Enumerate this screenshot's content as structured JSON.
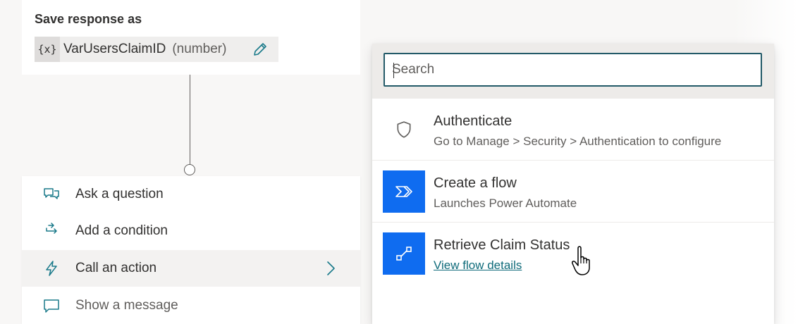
{
  "save_response": {
    "title": "Save response as",
    "var_icon": "{x}",
    "var_name": "VarUsersClaimID",
    "var_type": "(number)",
    "edit_icon": "pencil-icon"
  },
  "action_menu": {
    "items": [
      {
        "label": "Ask a question",
        "icon": "chat-question-icon"
      },
      {
        "label": "Add a condition",
        "icon": "branch-icon"
      },
      {
        "label": "Call an action",
        "icon": "lightning-icon"
      },
      {
        "label": "Show a message",
        "icon": "message-icon"
      }
    ]
  },
  "flyout": {
    "search": {
      "placeholder": "Search",
      "value": ""
    },
    "items": [
      {
        "title": "Authenticate",
        "subtitle": "Go to Manage > Security > Authentication to configure",
        "icon": "shield-icon"
      },
      {
        "title": "Create a flow",
        "subtitle": "Launches Power Automate",
        "icon": "power-automate-icon"
      },
      {
        "title": "Retrieve Claim Status",
        "link": "View flow details",
        "icon": "flow-icon"
      }
    ]
  },
  "colors": {
    "accent_blue": "#0f6cf0",
    "search_border": "#235a68",
    "link": "#0f6b7a",
    "icon_teal": "#1a7a8a"
  }
}
